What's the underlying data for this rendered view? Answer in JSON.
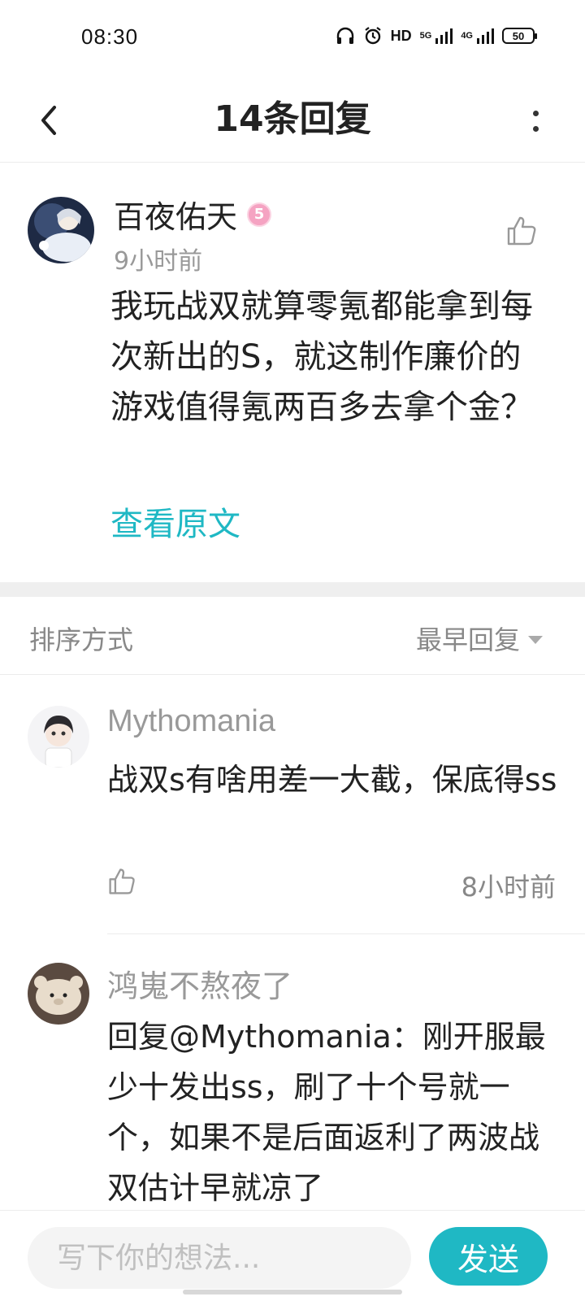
{
  "status_bar": {
    "time": "08:30",
    "network_hd": "HD",
    "network_5g": "5G",
    "network_4g": "4G",
    "battery": "50"
  },
  "header": {
    "title": "14条回复"
  },
  "main_comment": {
    "author": "百夜佑天",
    "level": "5",
    "time": "9小时前",
    "text": "我玩战双就算零氪都能拿到每次新出的S，就这制作廉价的游戏值得氪两百多去拿个金？",
    "view_original": "查看原文"
  },
  "sort": {
    "label": "排序方式",
    "selected": "最早回复"
  },
  "replies": [
    {
      "author": "Mythomania",
      "text": "战双s有啥用差一大截，保底得ss",
      "time": "8小时前"
    },
    {
      "author": "鸿嵬不熬夜了",
      "text": "回复@Mythomania：刚开服最少十发出ss，刷了十个号就一个，如果不是后面返利了两波战双估计早就凉了"
    }
  ],
  "composer": {
    "placeholder": "写下你的想法...",
    "send_label": "发送"
  },
  "colors": {
    "accent": "#1fb8c4",
    "level_badge": "#f5a3c2",
    "muted_text": "#999999"
  }
}
